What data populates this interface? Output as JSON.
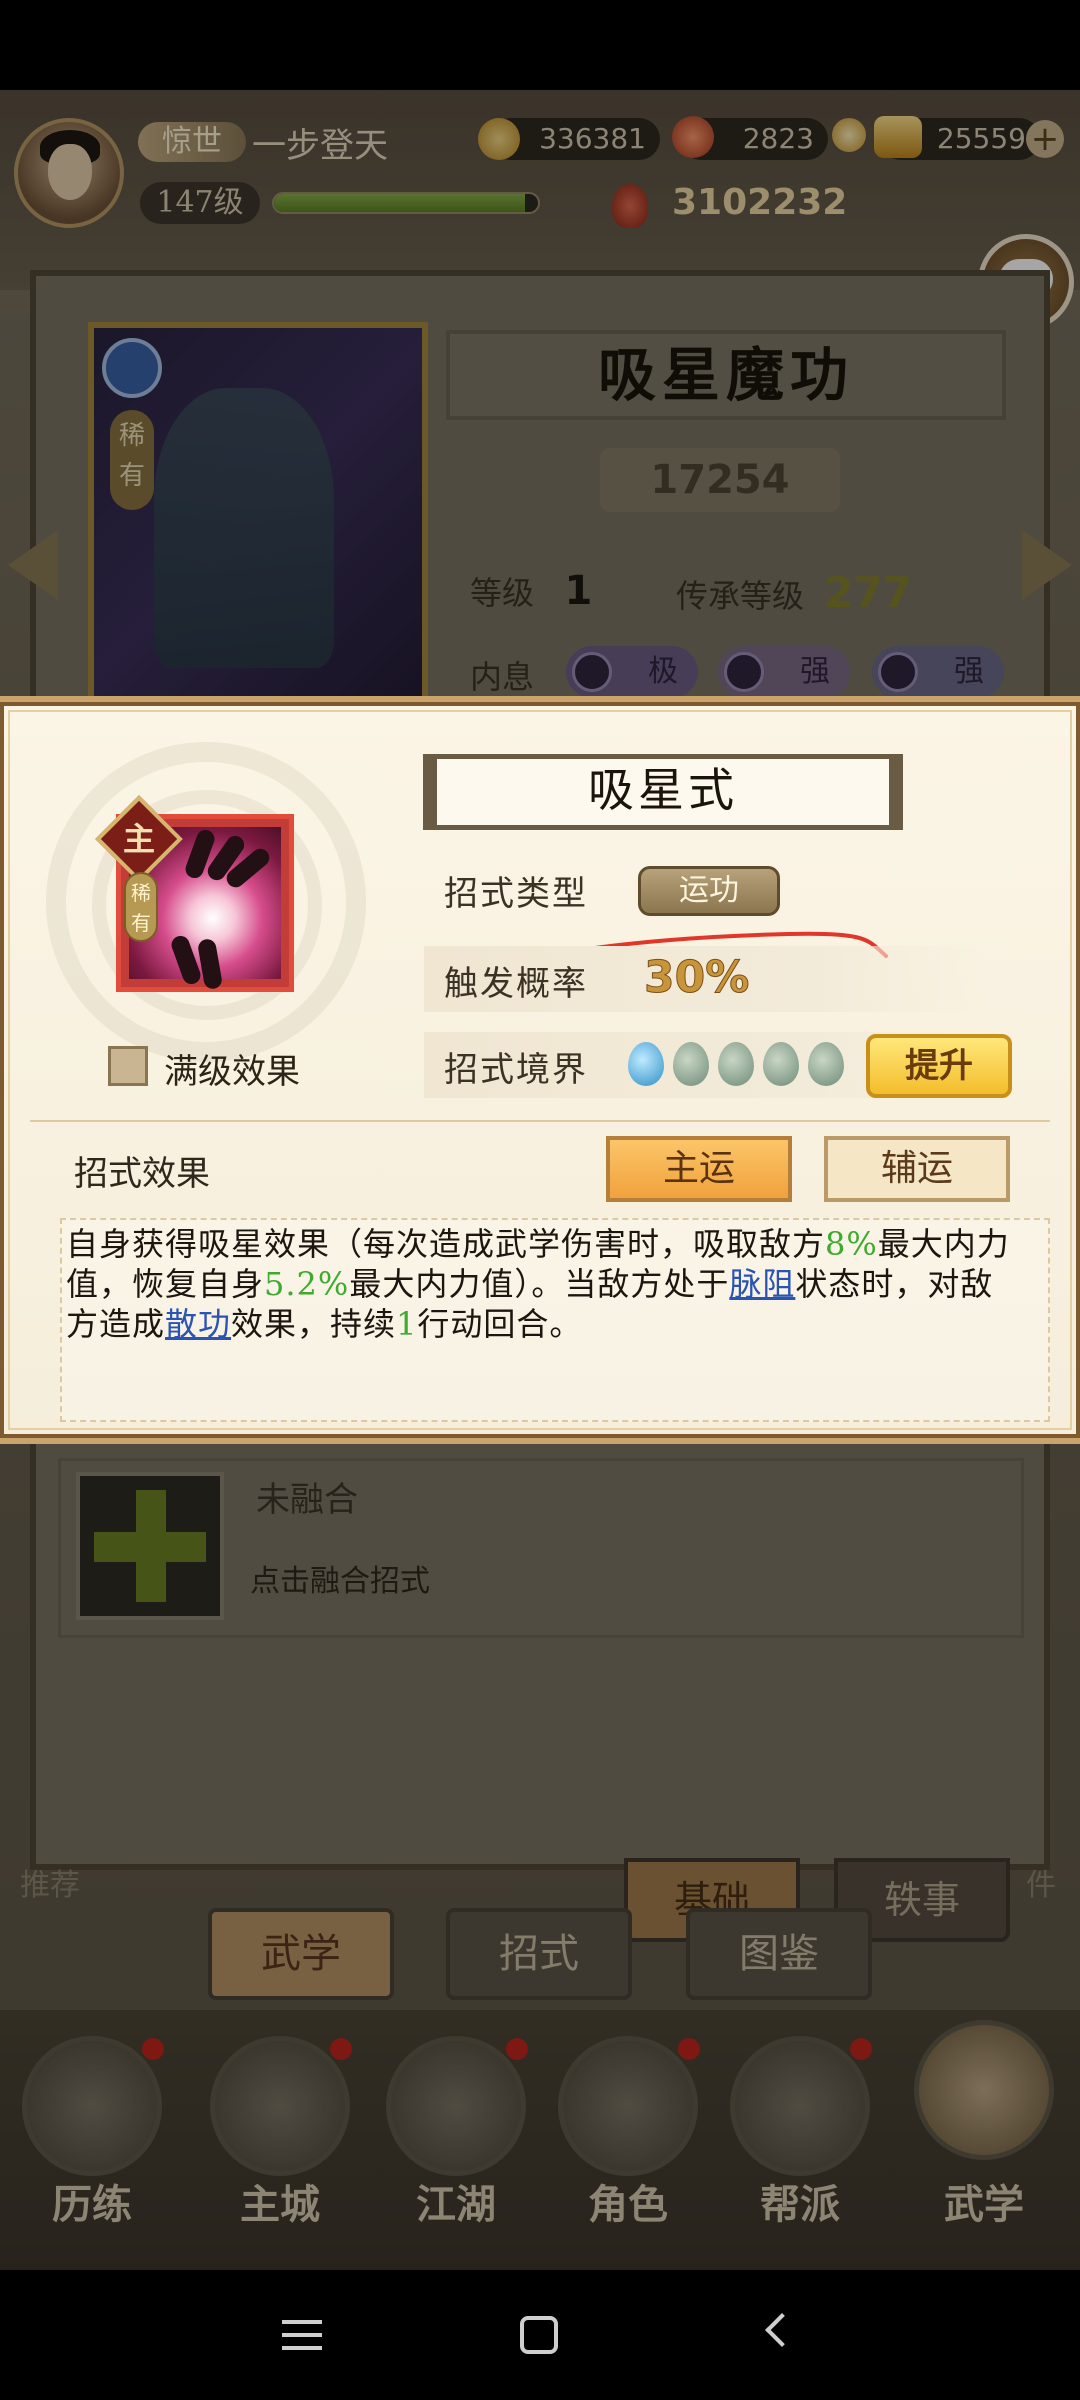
{
  "header": {
    "title_tag": "惊世",
    "player_name": "一步登天",
    "level": "147级",
    "exp_progress": 0.95,
    "coins": "336381",
    "gems": "2823",
    "gold": "25559",
    "power": "3102232"
  },
  "skill": {
    "name": "吸星魔功",
    "rarity": "稀有",
    "power": "17254",
    "level_label": "等级",
    "level_value": "1",
    "inherit_label": "传承等级",
    "inherit_value": "277",
    "neixi_label": "内息",
    "neixi": [
      "极",
      "强",
      "强"
    ]
  },
  "fusion": {
    "title": "未融合",
    "hint": "点击融合招式"
  },
  "tabs": [
    "武学",
    "招式",
    "图鉴"
  ],
  "subtabs": [
    "基础",
    "轶事"
  ],
  "side_labels": [
    "推荐",
    "件"
  ],
  "nav": [
    "历练",
    "主城",
    "江湖",
    "角色",
    "帮派",
    "武学"
  ],
  "modal": {
    "move_name": "吸星式",
    "main_badge": "主",
    "rarity_badge": "稀有",
    "max_level_label": "满级效果",
    "type_label": "招式类型",
    "type_value": "运功",
    "rate_label": "触发概率",
    "rate_value": "30%",
    "realm_label": "招式境界",
    "realm_level": 1,
    "realm_max": 5,
    "upgrade_label": "提升",
    "effect_label": "招式效果",
    "main_btn": "主运",
    "aux_btn": "辅运",
    "desc": {
      "p1": "自身获得吸星效果（每次造成武学伤害时，吸取敌方",
      "v1": "8%",
      "p2": "最大内力值，恢复自身",
      "v2": "5.2%",
      "p3": "最大内力值）。当敌方处于",
      "k1": "脉阻",
      "p4": "状态时，对敌方造成",
      "k2": "散功",
      "p5": "效果，持续",
      "v3": "1",
      "p6": "行动回合。"
    }
  },
  "colors": {
    "accent_orange": "#f0a23d",
    "highlight_green": "#3cab2e",
    "keyword_blue": "#2a53b3",
    "upgrade_yellow": "#f3bd2b"
  }
}
